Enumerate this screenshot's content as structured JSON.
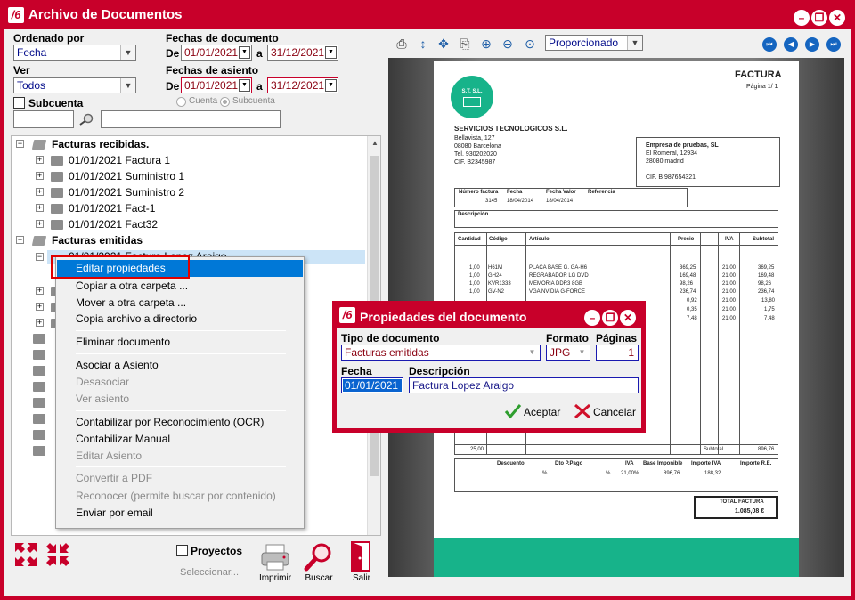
{
  "window": {
    "title": "Archivo de Documentos",
    "logo": "/6",
    "controls": [
      "–",
      "❐",
      "✕"
    ]
  },
  "filters": {
    "ordenado_label": "Ordenado por",
    "ordenado_value": "Fecha",
    "ver_label": "Ver",
    "ver_value": "Todos",
    "subcuenta_label": "Subcuenta",
    "fechas_doc_label": "Fechas de documento",
    "fechas_asiento_label": "Fechas de asiento",
    "de_label": "De",
    "a_label": "a",
    "doc_from": "01/01/2021",
    "doc_to": "31/12/2021",
    "asi_from": "01/01/2021",
    "asi_to": "31/12/2021",
    "radio_cuenta": "Cuenta",
    "radio_subcuenta": "Subcuenta"
  },
  "tree": {
    "recibidas": "Facturas recibidas.",
    "recibidas_items": [
      "01/01/2021 Factura 1",
      "01/01/2021 Suministro 1",
      "01/01/2021 Suministro 2",
      "01/01/2021 Fact-1",
      "01/01/2021 Fact32"
    ],
    "emitidas": "Facturas emitidas",
    "emitidas_selected": "01/01/2021 Factura Lopez Araigo"
  },
  "context_menu": {
    "items": [
      {
        "label": "Editar propiedades",
        "enabled": true,
        "highlighted": true
      },
      {
        "label": "Copiar a otra carpeta ...",
        "enabled": true
      },
      {
        "label": "Mover a otra carpeta ...",
        "enabled": true
      },
      {
        "label": "Copia archivo a directorio",
        "enabled": true
      },
      {
        "label": "Eliminar documento",
        "enabled": true
      },
      {
        "label": "Asociar a Asiento",
        "enabled": true
      },
      {
        "label": "Desasociar",
        "enabled": false
      },
      {
        "label": "Ver asiento",
        "enabled": false
      },
      {
        "label": "Contabilizar por Reconocimiento (OCR)",
        "enabled": true
      },
      {
        "label": "Contabilizar Manual",
        "enabled": true
      },
      {
        "label": "Editar Asiento",
        "enabled": false
      },
      {
        "label": "Convertir a PDF",
        "enabled": false
      },
      {
        "label": "Reconocer (permite buscar por contenido)",
        "enabled": false
      },
      {
        "label": "Enviar por email",
        "enabled": true
      }
    ]
  },
  "bottom": {
    "proyectos_label": "Proyectos",
    "seleccionar": "Seleccionar...",
    "imprimir": "Imprimir",
    "buscar": "Buscar",
    "salir": "Salir"
  },
  "viewer_toolbar": {
    "zoom_mode": "Proporcionado"
  },
  "invoice": {
    "title": "FACTURA",
    "page": "Página  1/  1",
    "logo_text": "S.T. S.L.",
    "company": "SERVICIOS TECNOLOGICOS S.L.",
    "company_lines": [
      "Bellavista, 127",
      "08080 Barcelona",
      "Tel. 930202020",
      "CIF. B2345987"
    ],
    "client_lines": [
      "Empresa de pruebas, SL",
      "El Romeral, 12934",
      "28080 madrid"
    ],
    "client_cif": "CIF. B 987654321",
    "meta_headers": [
      "Número factura",
      "Fecha",
      "Fecha Valor",
      "Referencia"
    ],
    "meta_values": [
      "3145",
      "18/04/2014",
      "18/04/2014",
      ""
    ],
    "descripcion_label": "Descripción",
    "line_headers": [
      "Cantidad",
      "Código",
      "Artículo",
      "Precio",
      "IVA",
      "Subtotal"
    ],
    "lines": [
      [
        "1,00",
        "H61M",
        "PLACA BASE G. GA-H6",
        "369,25",
        "21,00",
        "369,25"
      ],
      [
        "1,00",
        "GH24",
        "REGRABADOR LG DVD",
        "169,48",
        "21,00",
        "169,48"
      ],
      [
        "1,00",
        "KVR1333",
        "MEMORIA DDR3 8GB",
        "98,26",
        "21,00",
        "98,26"
      ],
      [
        "1,00",
        "GV-N2",
        "VGA NVIDIA G-FORCE",
        "236,74",
        "21,00",
        "236,74"
      ],
      [
        "",
        "",
        "",
        "0,92",
        "21,00",
        "13,80"
      ],
      [
        "",
        "",
        "",
        "0,35",
        "21,00",
        "1,75"
      ],
      [
        "",
        "",
        "",
        "7,48",
        "21,00",
        "7,48"
      ]
    ],
    "total_qty": "25,00",
    "subtotal_label": "Subtotal",
    "subtotal_value": "896,76",
    "summary_headers": [
      "Descuento",
      "Dto P.Pago",
      "IVA",
      "Base Imponible",
      "Importe IVA",
      "Importe R.E."
    ],
    "summary_values": [
      "%",
      "%",
      "21,00%",
      "896,76",
      "188,32",
      ""
    ],
    "total_label": "TOTAL FACTURA",
    "total_value": "1.085,08 €"
  },
  "dialog": {
    "title": "Propiedades del documento",
    "tipo_label": "Tipo de documento",
    "tipo_value": "Facturas emitidas",
    "formato_label": "Formato",
    "formato_value": "JPG",
    "paginas_label": "Páginas",
    "paginas_value": "1",
    "fecha_label": "Fecha",
    "fecha_value": "01/01/2021",
    "descripcion_label": "Descripción",
    "descripcion_value": "Factura Lopez Araigo",
    "accept": "Aceptar",
    "cancel": "Cancelar"
  },
  "colors": {
    "brand": "#c8002a",
    "selection": "#0078d7",
    "accent_teal": "#17b38a"
  }
}
